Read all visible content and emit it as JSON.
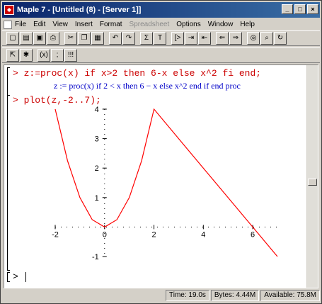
{
  "window": {
    "title": "Maple 7 - [Untitled (8) - [Server 1]]",
    "controls": [
      "_",
      "□",
      "×"
    ]
  },
  "menubar": [
    {
      "label": "File",
      "enabled": true
    },
    {
      "label": "Edit",
      "enabled": true
    },
    {
      "label": "View",
      "enabled": true
    },
    {
      "label": "Insert",
      "enabled": true
    },
    {
      "label": "Format",
      "enabled": true
    },
    {
      "label": "Spreadsheet",
      "enabled": false
    },
    {
      "label": "Options",
      "enabled": true
    },
    {
      "label": "Window",
      "enabled": true
    },
    {
      "label": "Help",
      "enabled": true
    }
  ],
  "toolbar1": [
    {
      "icon": "new-icon",
      "glyph": "▢"
    },
    {
      "icon": "open-icon",
      "glyph": "▤"
    },
    {
      "icon": "save-icon",
      "glyph": "▣"
    },
    {
      "icon": "print-icon",
      "glyph": "⎙"
    },
    {
      "icon": "cut-icon",
      "glyph": "✂"
    },
    {
      "icon": "copy-icon",
      "glyph": "❐"
    },
    {
      "icon": "paste-icon",
      "glyph": "▦"
    },
    {
      "icon": "undo-icon",
      "glyph": "↶"
    },
    {
      "icon": "redo-icon",
      "glyph": "↷"
    },
    {
      "icon": "sum-icon",
      "glyph": "Σ"
    },
    {
      "icon": "text-icon",
      "glyph": "T"
    },
    {
      "icon": "prompt-icon",
      "glyph": "[>"
    },
    {
      "icon": "indent-icon",
      "glyph": "⇥"
    },
    {
      "icon": "outdent-icon",
      "glyph": "⇤"
    },
    {
      "icon": "back-icon",
      "glyph": "⇐"
    },
    {
      "icon": "forward-icon",
      "glyph": "⇒"
    },
    {
      "icon": "stop-icon",
      "glyph": "◎"
    },
    {
      "icon": "zoom-icon",
      "glyph": "⌕"
    },
    {
      "icon": "restart-icon",
      "glyph": "↻"
    }
  ],
  "toolbar2": [
    {
      "icon": "execute-icon",
      "glyph": "⇱"
    },
    {
      "icon": "execute-all-icon",
      "glyph": "✱"
    },
    {
      "icon": "expression-icon",
      "glyph": "(x)"
    },
    {
      "icon": "colon-icon",
      "glyph": ";"
    },
    {
      "icon": "execute-worksheet-icon",
      "glyph": "!!!"
    }
  ],
  "worksheet": {
    "input1": "> z:=proc(x) if x>2 then 6-x else x^2 fi end;",
    "output1": "z := proc(x) if 2 < x then 6 − x else x^2 end if end proc",
    "input2": "> plot(z,-2..7);",
    "input3": "> "
  },
  "chart_data": {
    "type": "line",
    "title": "",
    "xlabel": "",
    "ylabel": "",
    "xlim": [
      -2,
      7
    ],
    "ylim": [
      -1,
      4
    ],
    "x_ticks": [
      "-2",
      "0",
      "2",
      "4",
      "6"
    ],
    "y_ticks": [
      "-1",
      "1",
      "2",
      "3",
      "4"
    ],
    "color": "#ff0000",
    "series": [
      {
        "x": [
          -2,
          -1.5,
          -1,
          -0.5,
          0,
          0.5,
          1,
          1.5,
          2,
          3,
          4,
          5,
          6,
          7
        ],
        "values": [
          4,
          2.25,
          1,
          0.25,
          0,
          0.25,
          1,
          2.25,
          4,
          3,
          2,
          1,
          0,
          -1
        ]
      }
    ]
  },
  "statusbar": {
    "time": "Time: 19.0s",
    "bytes": "Bytes: 4.44M",
    "available": "Available: 75.8M"
  }
}
